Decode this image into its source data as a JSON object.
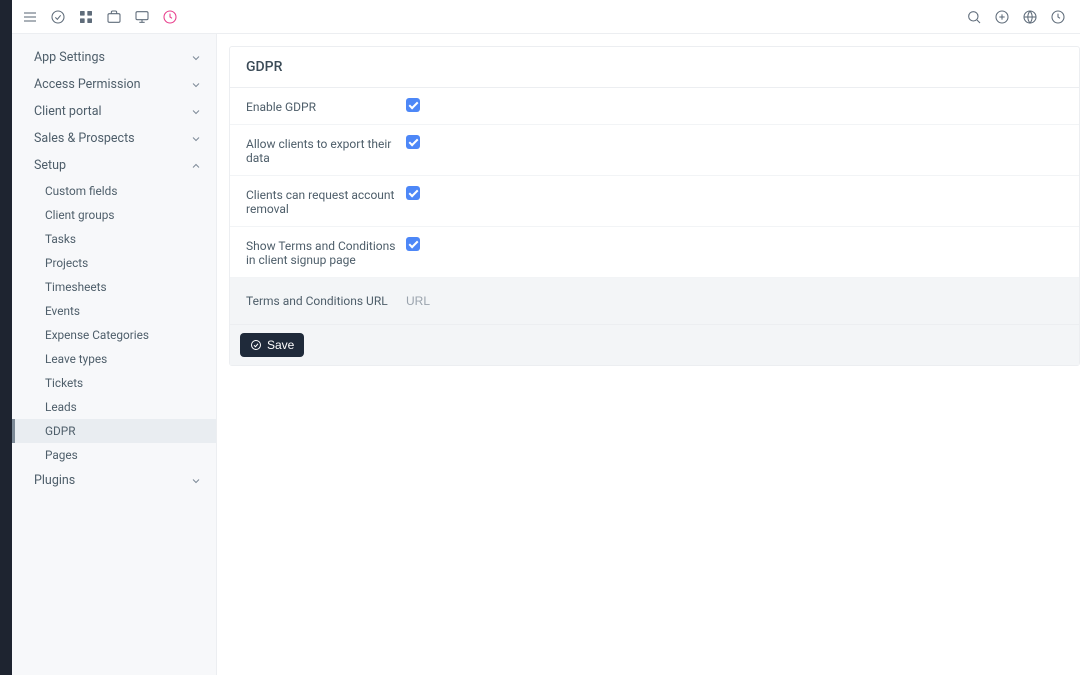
{
  "topbar": {
    "icons_left": [
      "menu",
      "check-circle",
      "grid",
      "briefcase",
      "monitor",
      "activity"
    ],
    "icons_right": [
      "search",
      "plus-circle",
      "globe",
      "clock"
    ]
  },
  "sidebar": {
    "sections": [
      {
        "label": "App Settings",
        "expanded": false
      },
      {
        "label": "Access Permission",
        "expanded": false
      },
      {
        "label": "Client portal",
        "expanded": false
      },
      {
        "label": "Sales & Prospects",
        "expanded": false
      },
      {
        "label": "Setup",
        "expanded": true
      },
      {
        "label": "Plugins",
        "expanded": false
      }
    ],
    "setup_items": [
      "Custom fields",
      "Client groups",
      "Tasks",
      "Projects",
      "Timesheets",
      "Events",
      "Expense Categories",
      "Leave types",
      "Tickets",
      "Leads",
      "GDPR",
      "Pages"
    ],
    "active_setup_item": "GDPR"
  },
  "page": {
    "title": "GDPR",
    "fields": {
      "enable_gdpr": {
        "label": "Enable GDPR",
        "checked": true
      },
      "allow_export": {
        "label": "Allow clients to export their data",
        "checked": true
      },
      "request_removal": {
        "label": "Clients can request account removal",
        "checked": true
      },
      "show_terms": {
        "label": "Show Terms and Conditions in client signup page",
        "checked": true
      },
      "terms_url": {
        "label": "Terms and Conditions URL",
        "placeholder": "URL",
        "value": ""
      }
    },
    "save_label": "Save"
  }
}
